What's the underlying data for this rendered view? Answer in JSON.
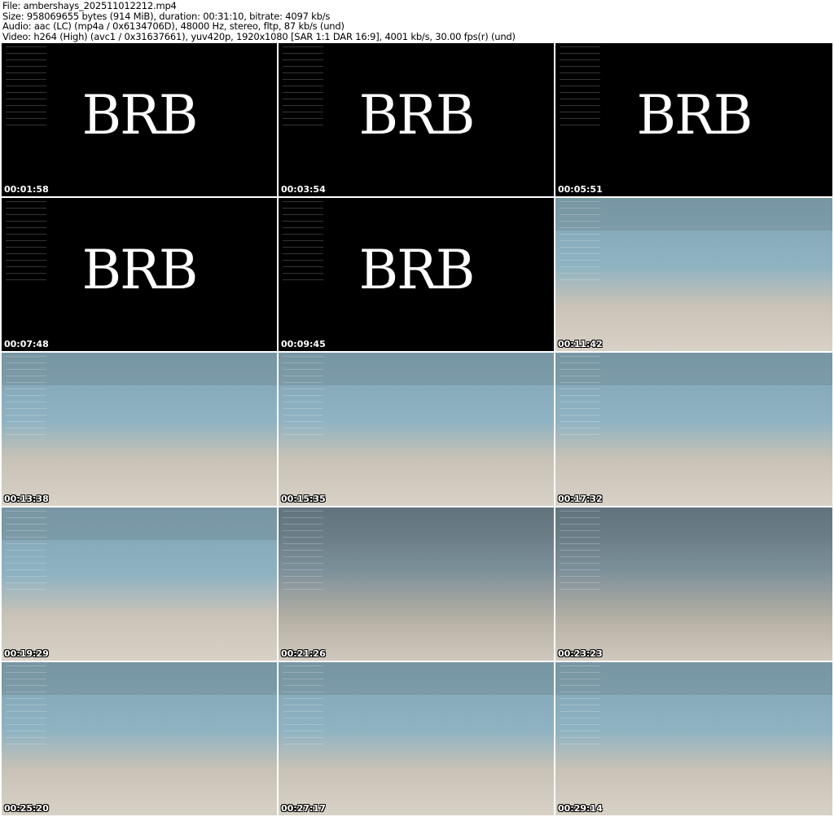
{
  "header": {
    "file": "File: ambershays_202511012212.mp4",
    "size": "Size: 958069655 bytes (914 MiB), duration: 00:31:10, bitrate: 4097 kb/s",
    "audio": "Audio: aac (LC) (mp4a / 0x6134706D), 48000 Hz, stereo, fltp, 87 kb/s (und)",
    "video": "Video: h264 (High) (avc1 / 0x31637661), yuv420p, 1920x1080 [SAR 1:1 DAR 16:9], 4001 kb/s, 30.00 fps(r) (und)"
  },
  "frames": [
    {
      "timestamp": "00:01:58",
      "text": "BRB"
    },
    {
      "timestamp": "00:03:54",
      "text": "BRB"
    },
    {
      "timestamp": "00:05:51",
      "text": "BRB"
    },
    {
      "timestamp": "00:07:48",
      "text": "BRB"
    },
    {
      "timestamp": "00:09:45",
      "text": "BRB"
    },
    {
      "timestamp": "00:11:42"
    },
    {
      "timestamp": "00:13:38"
    },
    {
      "timestamp": "00:15:35"
    },
    {
      "timestamp": "00:17:32"
    },
    {
      "timestamp": "00:19:29"
    },
    {
      "timestamp": "00:21:26"
    },
    {
      "timestamp": "00:23:23"
    },
    {
      "timestamp": "00:25:20"
    },
    {
      "timestamp": "00:27:17"
    },
    {
      "timestamp": "00:29:14"
    }
  ]
}
